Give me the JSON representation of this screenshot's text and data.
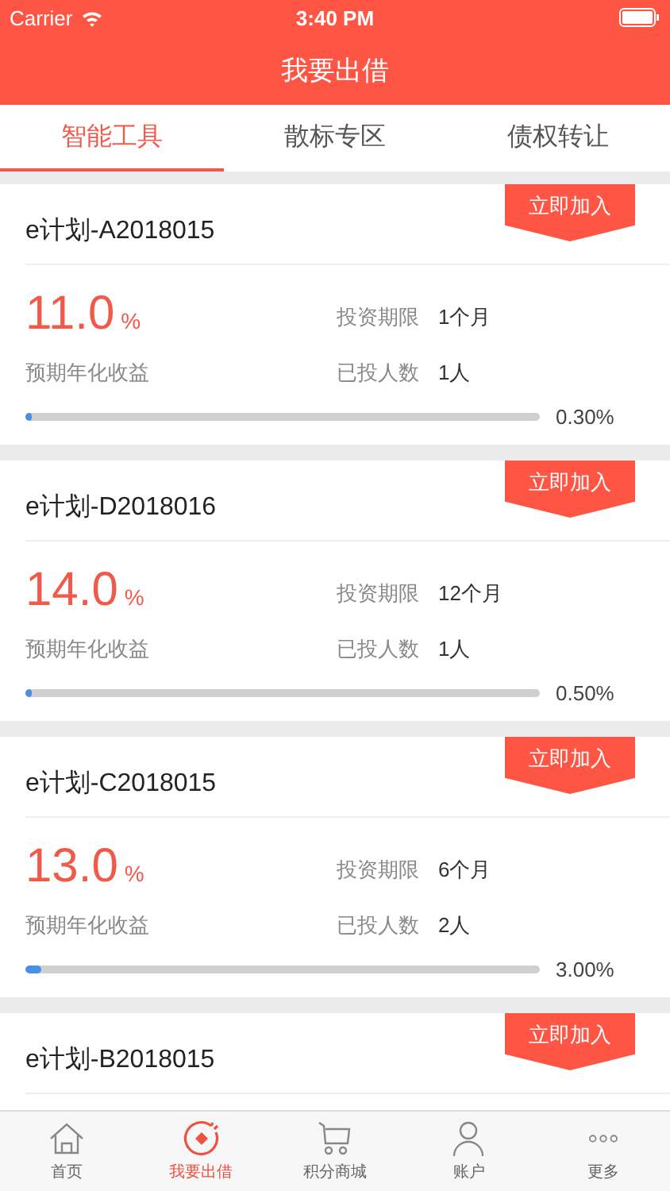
{
  "status_bar": {
    "carrier": "Carrier",
    "time": "3:40 PM"
  },
  "nav": {
    "title": "我要出借"
  },
  "tabs": [
    {
      "label": "智能工具",
      "selected": true
    },
    {
      "label": "散标专区",
      "selected": false
    },
    {
      "label": "债权转让",
      "selected": false
    }
  ],
  "products": [
    {
      "name": "e计划-A2018015",
      "button": "立即加入",
      "rate": "11.0",
      "rate_unit": "%",
      "rate_label": "预期年化收益",
      "term_label": "投资期限",
      "term": "1个月",
      "investors_label": "已投人数",
      "investors": "1人",
      "level": 0.003,
      "progress": "0.30%"
    },
    {
      "name": "e计划-D2018016",
      "button": "立即加入",
      "rate": "14.0",
      "rate_unit": "%",
      "rate_label": "预期年化收益",
      "term_label": "投资期限",
      "term": "12个月",
      "investors_label": "已投人数",
      "investors": "1人",
      "level": 0.005,
      "progress": "0.50%"
    },
    {
      "name": "e计划-C2018015",
      "button": "立即加入",
      "rate": "13.0",
      "rate_unit": "%",
      "rate_label": "预期年化收益",
      "term_label": "投资期限",
      "term": "6个月",
      "investors_label": "已投人数",
      "investors": "2人",
      "level": 0.03,
      "progress": "3.00%"
    },
    {
      "name": "e计划-B2018015",
      "button": "立即加入"
    }
  ],
  "tab_bar": [
    {
      "kind": "home",
      "label": "首页",
      "selected": false
    },
    {
      "kind": "lend",
      "label": "我要出借",
      "selected": true
    },
    {
      "kind": "shop",
      "label": "积分商城",
      "selected": false
    },
    {
      "kind": "account",
      "label": "账户",
      "selected": false
    },
    {
      "kind": "more",
      "label": "更多",
      "selected": false
    }
  ]
}
